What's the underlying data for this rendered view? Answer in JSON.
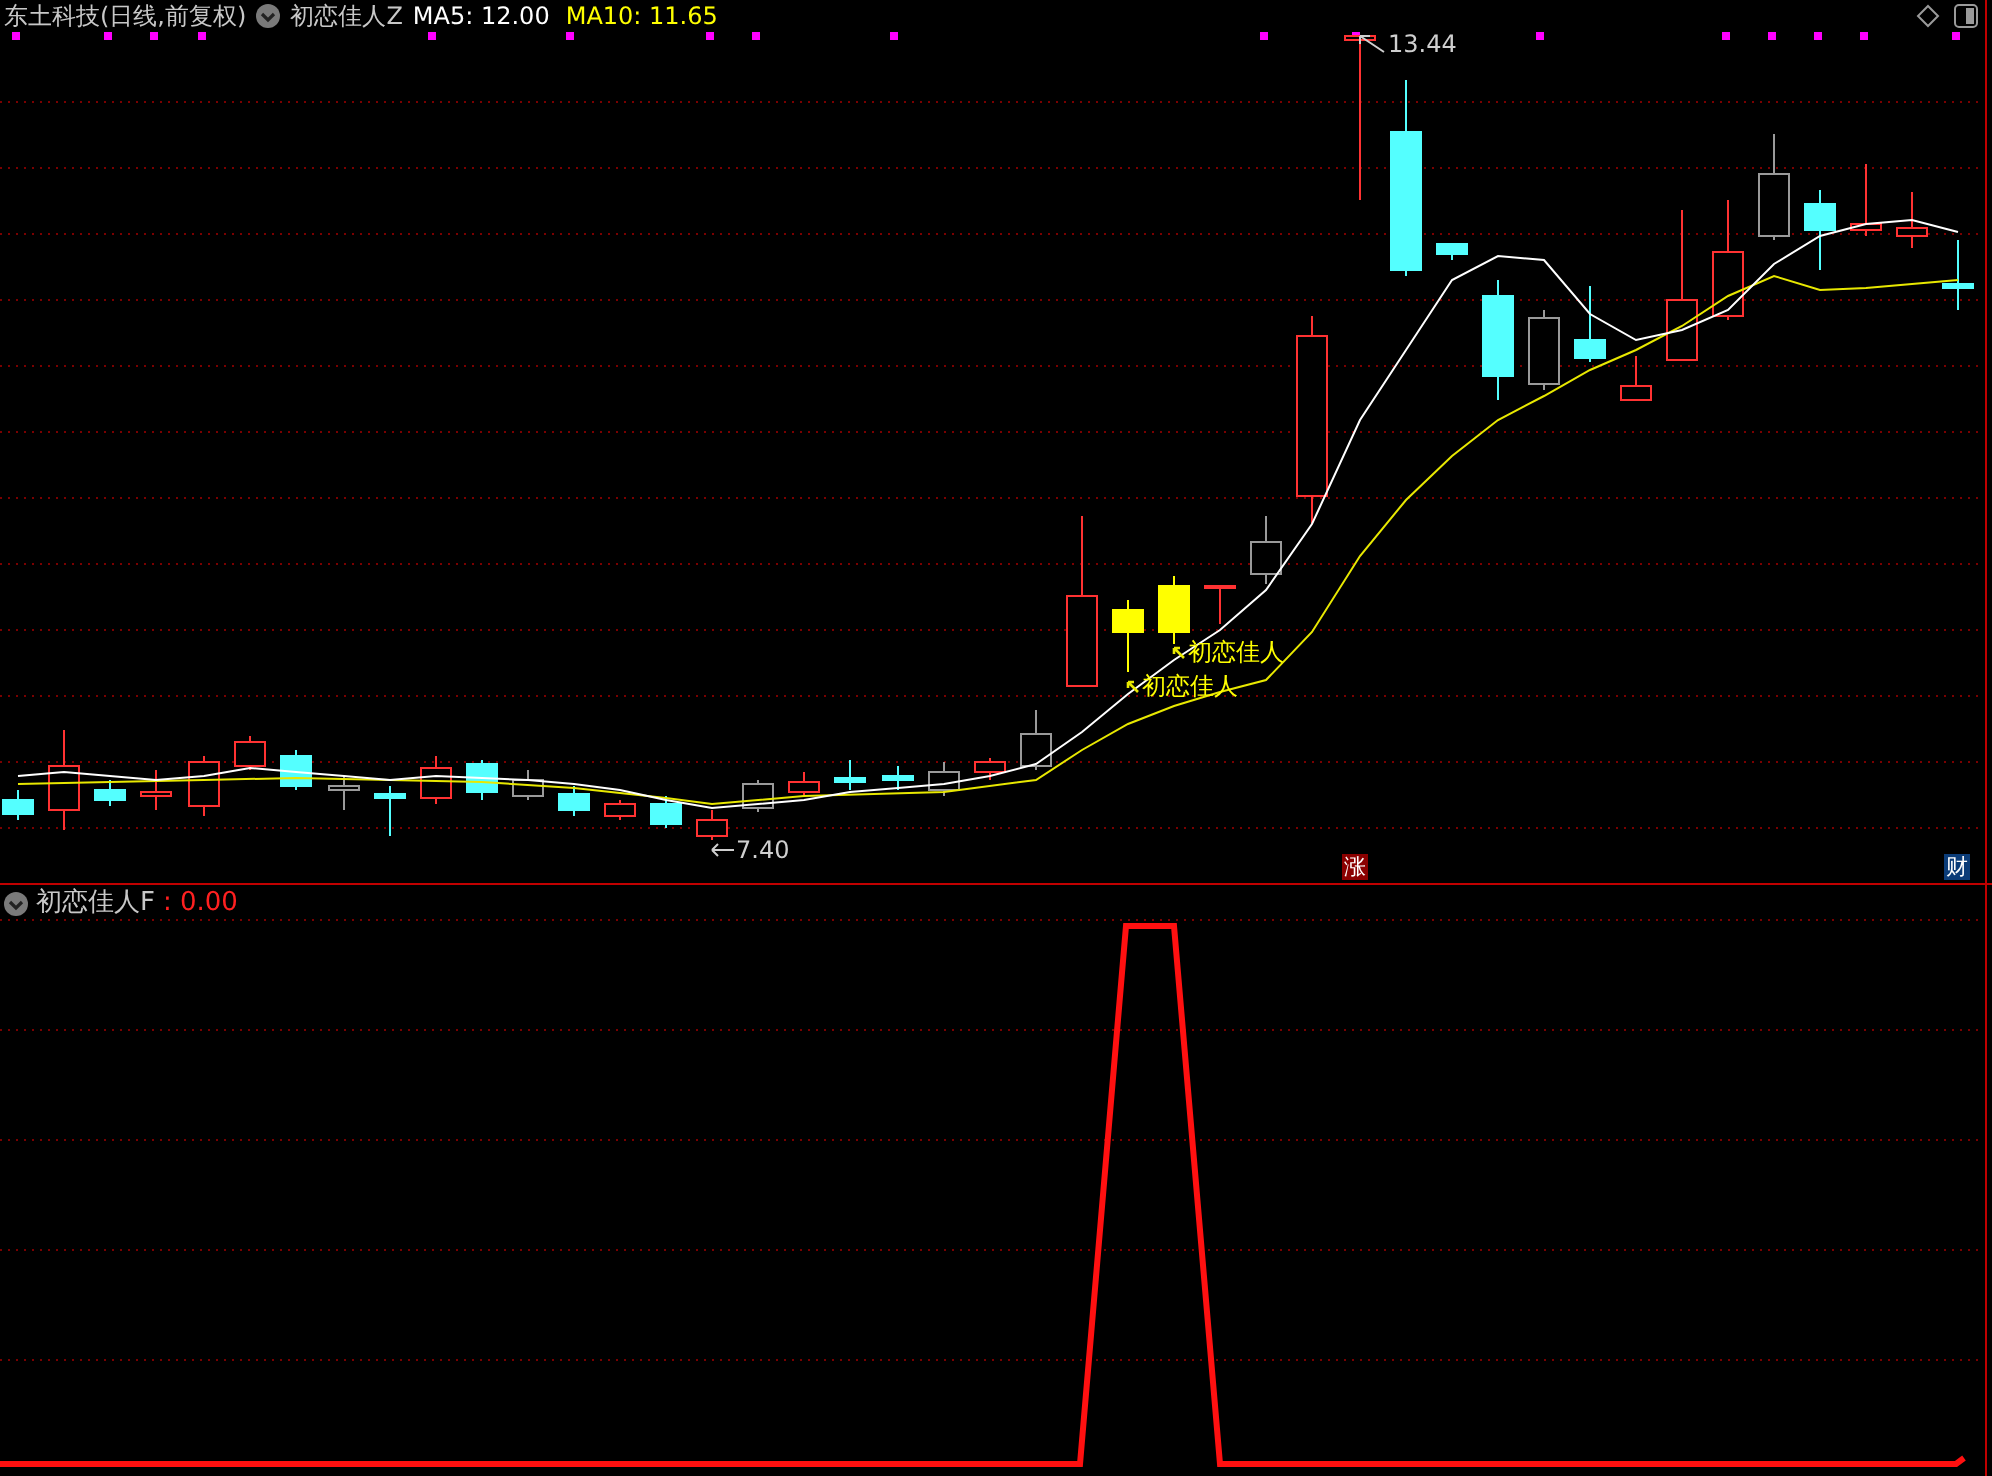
{
  "main_panel": {
    "stock_title": "东土科技(日线,前复权)",
    "indicator_name": "初恋佳人Z",
    "ma_readings": [
      {
        "label": "MA5: 12.00",
        "color": "#ffffff"
      },
      {
        "label": "MA10: 11.65",
        "color": "#ffff00"
      }
    ],
    "high_label": "13.44",
    "low_label": "7.40",
    "signal_labels": [
      "初恋佳人",
      "初恋佳人"
    ],
    "badges": [
      {
        "text": "涨",
        "color": "#8b0000"
      },
      {
        "text": "财",
        "color": "#0b3c78"
      }
    ]
  },
  "sub_panel": {
    "indicator_name": "初恋佳人F",
    "reading": ": 0.00"
  }
}
